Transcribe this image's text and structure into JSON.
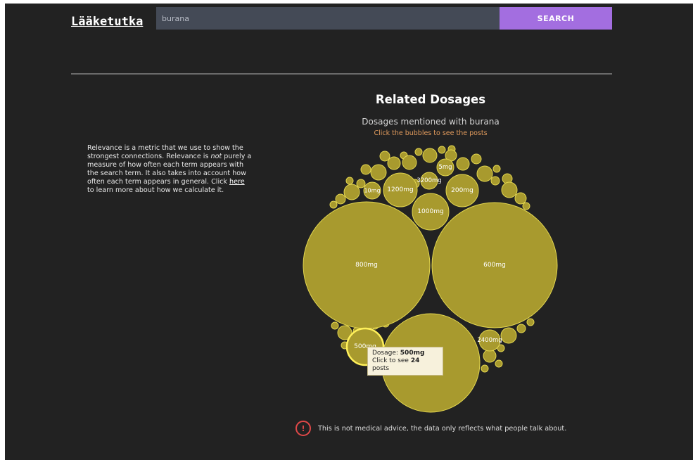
{
  "header": {
    "logo": "Lääketutka",
    "search_value": "burana",
    "search_button": "SEARCH"
  },
  "related": {
    "title": "Related Dosages",
    "subtitle": "Dosages mentioned with burana",
    "hint": "Click the bubbles to see the posts"
  },
  "relevance_note": {
    "before": "Relevance is a metric that we use to show the strongest connections. Relevance is ",
    "emphasis": "not",
    "middle": " purely a measure of how often each term appears with the search term. It also takes into account how often each term appears in general. Click ",
    "link": "here",
    "after": " to learn more about how we calculate it."
  },
  "tooltip": {
    "dosage_label": "Dosage: ",
    "dosage_value": "500mg",
    "posts_prefix": "Click to see ",
    "posts_count": "24",
    "posts_suffix": " posts"
  },
  "disclaimer": {
    "icon_glyph": "!",
    "text": "This is not medical advice, the data only reflects what people talk about."
  },
  "bubbles": {
    "fill": "#a89a2e",
    "stroke": "#e3d64f",
    "highlight_stroke": "#fff05a",
    "label_color": "#ffffff",
    "labels": [
      "800mg",
      "600mg",
      "500mg",
      "2400mg",
      "1000mg",
      "1200mg",
      "200mg",
      "3200mg",
      "10mg",
      "5mg"
    ],
    "highlighted": "500mg"
  },
  "colors": {
    "background": "#222222",
    "search_button": "#a36ee0",
    "hint": "#e09a5c",
    "warning": "#e04848"
  }
}
